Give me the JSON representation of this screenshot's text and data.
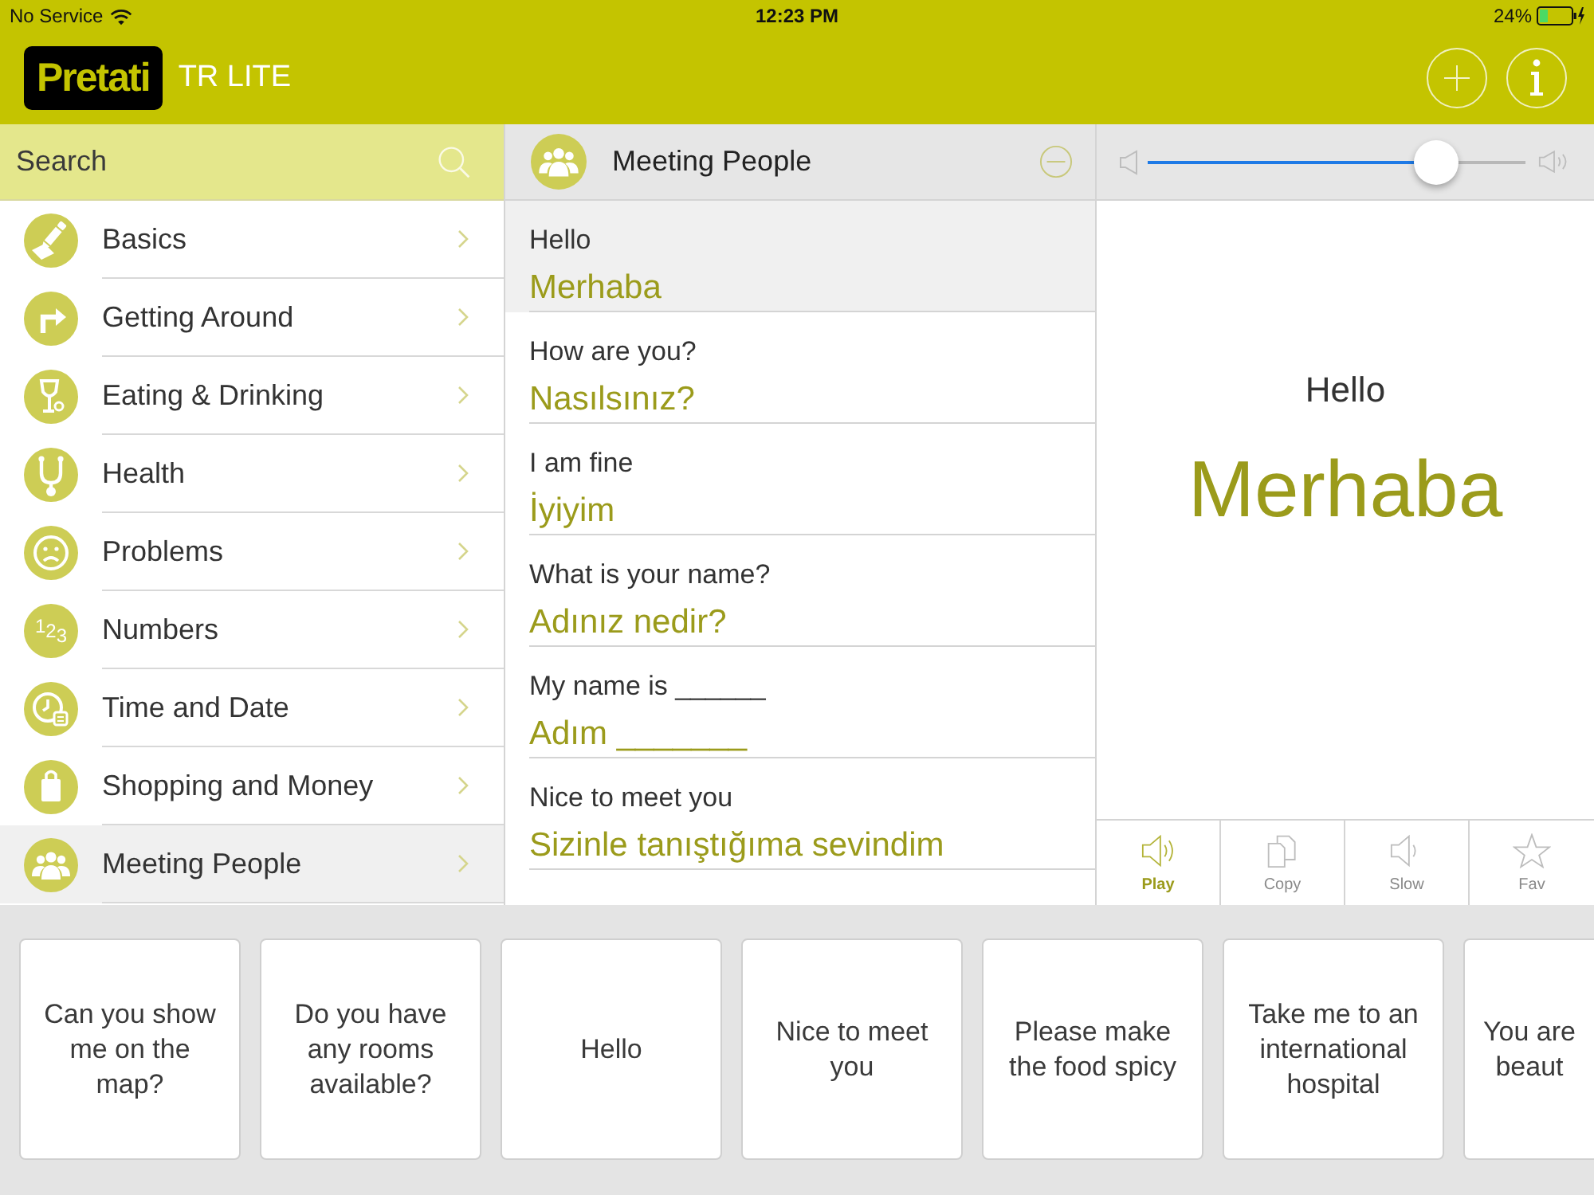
{
  "status_bar": {
    "carrier": "No Service",
    "time": "12:23 PM",
    "battery": "24%"
  },
  "header": {
    "logo": "Pretati",
    "subtitle": "TR LITE",
    "buttons": [
      {
        "kind": "add"
      },
      {
        "kind": "info"
      }
    ]
  },
  "sidebar": {
    "search": {
      "placeholder": "Search"
    },
    "items": [
      {
        "label": "Basics",
        "kind": "writing",
        "selected": false
      },
      {
        "label": "Getting Around",
        "kind": "directions",
        "selected": false
      },
      {
        "label": "Eating & Drinking",
        "kind": "dining",
        "selected": false
      },
      {
        "label": "Health",
        "kind": "health",
        "selected": false
      },
      {
        "label": "Problems",
        "kind": "problems",
        "selected": false
      },
      {
        "label": "Numbers",
        "kind": "digits",
        "icon_text": "123",
        "selected": false
      },
      {
        "label": "Time and Date",
        "kind": "time",
        "selected": false
      },
      {
        "label": "Shopping and Money",
        "kind": "shopping",
        "selected": false
      },
      {
        "label": "Meeting People",
        "kind": "people",
        "selected": true
      }
    ]
  },
  "phrase_list": {
    "title": "Meeting People",
    "phrases": [
      {
        "source": "Hello",
        "translation": "Merhaba",
        "selected": true
      },
      {
        "source": "How are you?",
        "translation": "Nasılsınız?",
        "selected": false
      },
      {
        "source": "I am fine",
        "translation": "İyiyim",
        "selected": false
      },
      {
        "source": "What is your name?",
        "translation": "Adınız nedir?",
        "selected": false
      },
      {
        "source": "My name is ______",
        "translation": "Adım _______",
        "selected": false
      },
      {
        "source": "Nice to meet you",
        "translation": "Sizinle tanıştığıma sevindim",
        "selected": false
      }
    ]
  },
  "player": {
    "volume": {
      "level": 0.8
    },
    "source": "Hello",
    "translation": "Merhaba",
    "actions": [
      {
        "label": "Play",
        "kind": "play",
        "selected": true
      },
      {
        "label": "Copy",
        "kind": "copy",
        "selected": false
      },
      {
        "label": "Slow",
        "kind": "slow",
        "selected": false
      },
      {
        "label": "Fav",
        "kind": "favorite",
        "selected": false
      }
    ]
  },
  "quick_phrases": [
    "Can you show me on the map?",
    "Do you have any rooms available?",
    "Hello",
    "Nice to meet you",
    "Please make the food spicy",
    "Take me to an international hospital",
    "You are beaut"
  ]
}
